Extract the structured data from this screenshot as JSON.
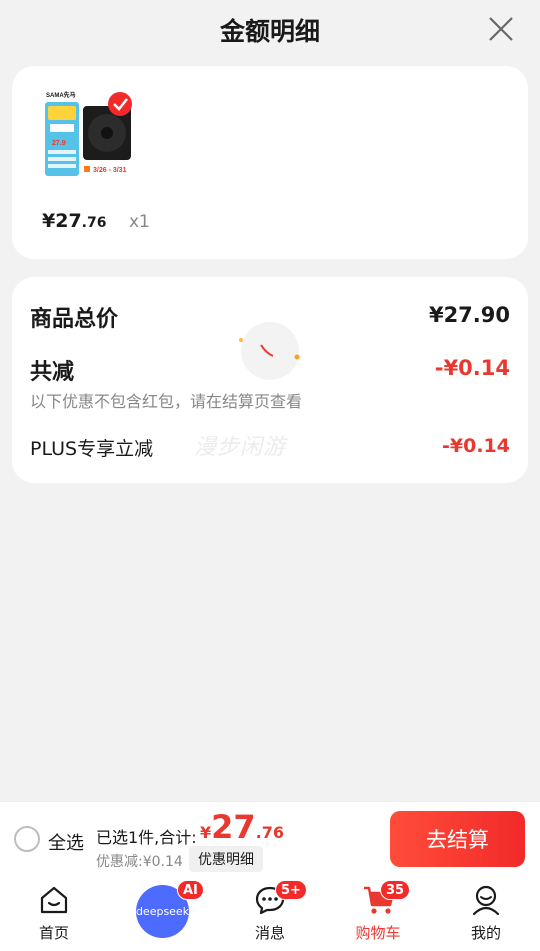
{
  "header": {
    "title": "金额明细"
  },
  "product": {
    "price_int": "¥27",
    "price_dec": ".76",
    "qty": "x1",
    "thumb_text": {
      "brand": "SAMA先马",
      "price_tag": "27.9",
      "date_range": "3/26 - 3/31"
    }
  },
  "detail": {
    "total_label": "商品总价",
    "total_value": "¥27.90",
    "reduce_label": "共减",
    "reduce_value": "-¥0.14",
    "note": "以下优惠不包含红包，请在结算页查看",
    "plus_label": "PLUS专享立减",
    "plus_value": "-¥0.14",
    "watermark": "漫步闲游"
  },
  "checkout": {
    "select_all": "全选",
    "summary": "已选1件,合计:",
    "total_sym": "¥",
    "total_int": "27",
    "total_dec": ".76",
    "discount": "优惠减:¥0.14",
    "discount_btn": "优惠明细",
    "checkout_btn": "去结算"
  },
  "tabbar": {
    "home": "首页",
    "deepseek": "deepseek",
    "ai_badge": "AI",
    "messages": "消息",
    "messages_badge": "5+",
    "cart": "购物车",
    "cart_badge": "35",
    "mine": "我的"
  },
  "colors": {
    "accent": "#e9382f",
    "deepseek": "#4d6bfe"
  }
}
